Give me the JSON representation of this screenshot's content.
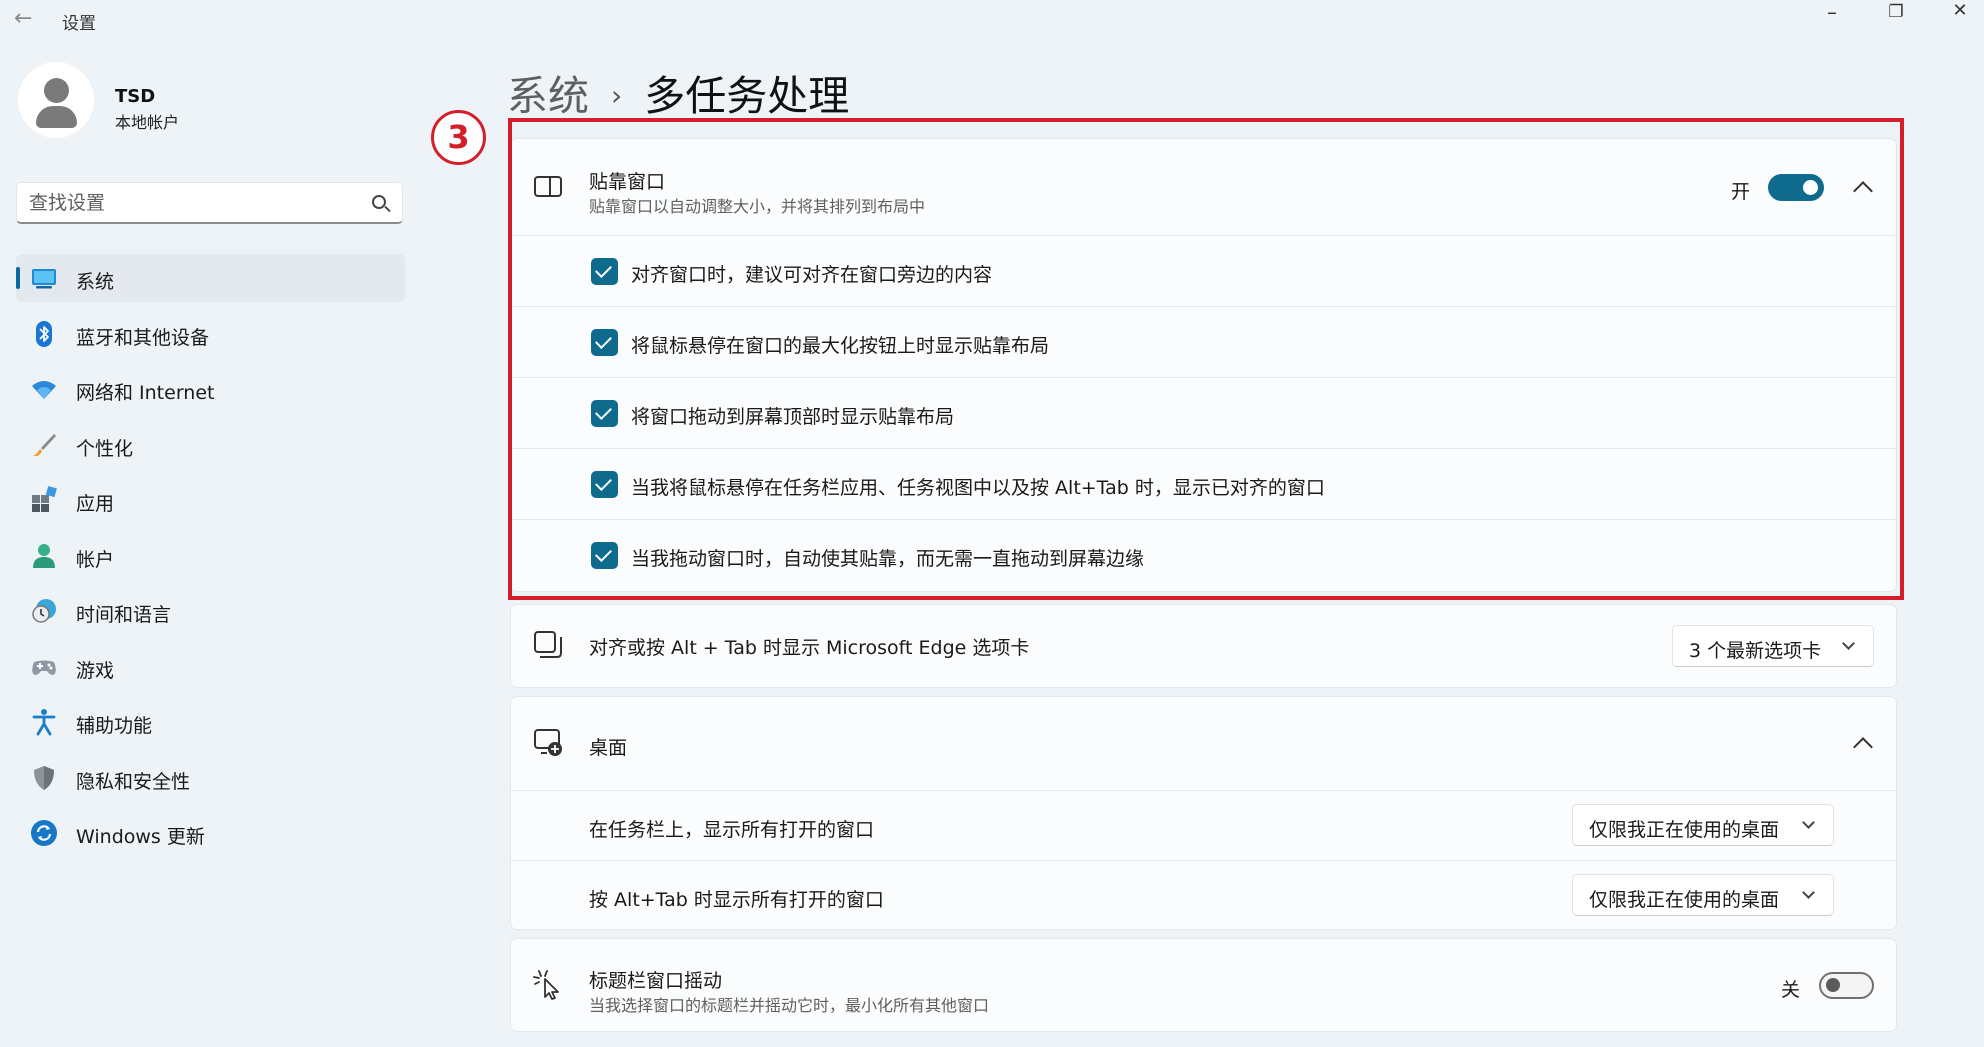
{
  "window": {
    "title": "设置",
    "back": "←",
    "minimize": "–",
    "restore": "❐",
    "close": "✕"
  },
  "profile": {
    "name": "TSD",
    "account_type": "本地帐户"
  },
  "search": {
    "placeholder": "查找设置"
  },
  "nav": {
    "items": [
      {
        "label": "系统",
        "icon": "system-icon",
        "active": true
      },
      {
        "label": "蓝牙和其他设备",
        "icon": "bluetooth-icon"
      },
      {
        "label": "网络和 Internet",
        "icon": "wifi-icon"
      },
      {
        "label": "个性化",
        "icon": "brush-icon"
      },
      {
        "label": "应用",
        "icon": "apps-icon"
      },
      {
        "label": "帐户",
        "icon": "account-icon"
      },
      {
        "label": "时间和语言",
        "icon": "clock-globe-icon"
      },
      {
        "label": "游戏",
        "icon": "gamepad-icon"
      },
      {
        "label": "辅助功能",
        "icon": "accessibility-icon"
      },
      {
        "label": "隐私和安全性",
        "icon": "shield-icon"
      },
      {
        "label": "Windows 更新",
        "icon": "update-icon"
      }
    ]
  },
  "breadcrumb": {
    "parent": "系统",
    "separator": "›",
    "current": "多任务处理"
  },
  "annotation": {
    "step": "3",
    "color": "#d41f2a"
  },
  "snap": {
    "title": "贴靠窗口",
    "description": "贴靠窗口以自动调整大小，并将其排列到布局中",
    "toggle_label": "开",
    "toggle_on": true,
    "options": [
      {
        "label": "对齐窗口时，建议可对齐在窗口旁边的内容",
        "checked": true
      },
      {
        "label": "将鼠标悬停在窗口的最大化按钮上时显示贴靠布局",
        "checked": true
      },
      {
        "label": "将窗口拖动到屏幕顶部时显示贴靠布局",
        "checked": true
      },
      {
        "label": "当我将鼠标悬停在任务栏应用、任务视图中以及按 Alt+Tab 时，显示已对齐的窗口",
        "checked": true
      },
      {
        "label": "当我拖动窗口时，自动使其贴靠，而无需一直拖动到屏幕边缘",
        "checked": true
      }
    ]
  },
  "edge_tabs": {
    "title": "对齐或按 Alt + Tab 时显示 Microsoft Edge 选项卡",
    "value": "3 个最新选项卡"
  },
  "desktops": {
    "title": "桌面",
    "rows": [
      {
        "label": "在任务栏上，显示所有打开的窗口",
        "value": "仅限我正在使用的桌面"
      },
      {
        "label": "按 Alt+Tab 时显示所有打开的窗口",
        "value": "仅限我正在使用的桌面"
      }
    ]
  },
  "shake": {
    "title": "标题栏窗口摇动",
    "description": "当我选择窗口的标题栏并摇动它时，最小化所有其他窗口",
    "toggle_label": "关",
    "toggle_on": false
  },
  "colors": {
    "accent": "#0f6b8e",
    "background": "#eef3f7",
    "card": "#fafcfd"
  }
}
